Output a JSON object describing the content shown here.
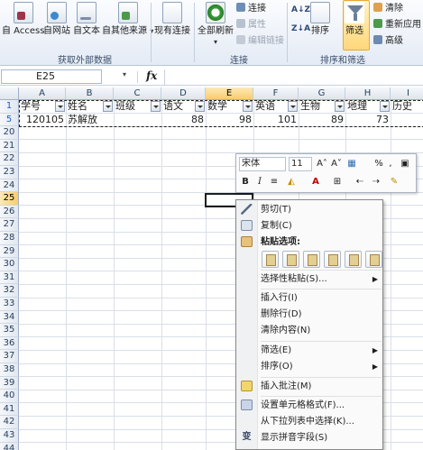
{
  "ribbon": {
    "from_access": "自 Access",
    "from_web": "自网站",
    "from_text": "自文本",
    "from_other": "自其他来源",
    "existing_connections": "现有连接",
    "refresh_all": "全部刷新",
    "connections": "连接",
    "properties": "属性",
    "edit_links": "编辑链接",
    "sort": "排序",
    "filter": "筛选",
    "clear": "清除",
    "reapply": "重新应用",
    "advanced": "高级",
    "group_external": "获取外部数据",
    "group_connections": "连接",
    "group_sort_filter": "排序和筛选",
    "sort_az": "A↓Z",
    "sort_za": "Z↓A"
  },
  "formula_bar": {
    "name_box": "E25",
    "fx": "fx",
    "value": ""
  },
  "columns": [
    "A",
    "B",
    "C",
    "D",
    "E",
    "F",
    "G",
    "H",
    "I"
  ],
  "rows": [
    "1",
    "5",
    "20",
    "21",
    "22",
    "23",
    "24",
    "25",
    "26",
    "27",
    "28",
    "29",
    "30",
    "31",
    "32",
    "33",
    "34",
    "35",
    "36",
    "37",
    "38",
    "39",
    "40",
    "41",
    "42",
    "43",
    "44"
  ],
  "header_row": [
    "学号",
    "姓名",
    "班级",
    "语文",
    "数学",
    "英语",
    "生物",
    "地理",
    "历史"
  ],
  "data_row": {
    "id": "120105",
    "name": "苏解放",
    "class": "",
    "chinese": "88",
    "math": "98",
    "english": "101",
    "biology": "89",
    "geography": "73"
  },
  "mini_toolbar": {
    "font": "宋体",
    "size": "11",
    "grow": "A˄",
    "shrink": "A˅",
    "percent": "%",
    "comma": ",",
    "bold": "B",
    "italic": "I",
    "align": "≡",
    "font_color": "A"
  },
  "context_menu": {
    "cut": "剪切(T)",
    "copy": "复制(C)",
    "paste_options": "粘贴选项:",
    "paste_special": "选择性粘贴(S)...",
    "insert_row": "插入行(I)",
    "delete_row": "删除行(D)",
    "clear_contents": "清除内容(N)",
    "filter": "筛选(E)",
    "sort": "排序(O)",
    "insert_comment": "插入批注(M)",
    "format_cells": "设置单元格格式(F)...",
    "pick_from_list": "从下拉列表中选择(K)...",
    "show_phonetic": "显示拼音字段(S)",
    "phonetic_icon": "变"
  }
}
